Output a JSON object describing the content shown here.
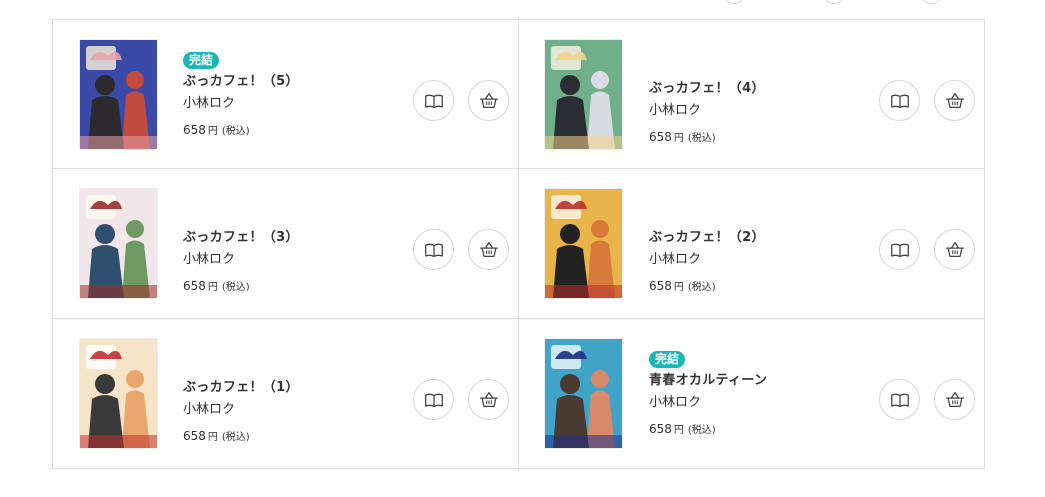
{
  "books": [
    {
      "badge": "完結",
      "title": "ぶっカフェ！（5）",
      "author": "小林ロク",
      "price": "658",
      "yen": "円",
      "tax": "(税込)",
      "cover": {
        "bg": "#3b4aa6",
        "accent": "#e8a3a8",
        "figure": "#2c2a2f",
        "figure2": "#c24a3f",
        "light": "#f2e6d8"
      }
    },
    {
      "badge": "",
      "title": "ぶっカフェ！（4）",
      "author": "小林ロク",
      "price": "658",
      "yen": "円",
      "tax": "(税込)",
      "cover": {
        "bg": "#6fb08a",
        "accent": "#f0d38a",
        "figure": "#2b2d33",
        "figure2": "#d9dbe3",
        "light": "#f4efe3"
      }
    },
    {
      "badge": "",
      "title": "ぶっカフェ！（3）",
      "author": "小林ロク",
      "price": "658",
      "yen": "円",
      "tax": "(税込)",
      "cover": {
        "bg": "#f1e7ea",
        "accent": "#9a2d2a",
        "figure": "#2e4f6e",
        "figure2": "#6e9a61",
        "light": "#fff8f2"
      }
    },
    {
      "badge": "",
      "title": "ぶっカフェ！（2）",
      "author": "小林ロク",
      "price": "658",
      "yen": "円",
      "tax": "(税込)",
      "cover": {
        "bg": "#e9b44a",
        "accent": "#b9302c",
        "figure": "#222222",
        "figure2": "#d87a3a",
        "light": "#fbf3e2"
      }
    },
    {
      "badge": "",
      "title": "ぶっカフェ！（1）",
      "author": "小林ロク",
      "price": "658",
      "yen": "円",
      "tax": "(税込)",
      "cover": {
        "bg": "#f6e4c8",
        "accent": "#c2302c",
        "figure": "#3a3a3a",
        "figure2": "#e9a66d",
        "light": "#ffffff"
      }
    },
    {
      "badge": "完結",
      "title": "青春オカルティーン",
      "author": "小林ロク",
      "price": "658",
      "yen": "円",
      "tax": "(税込)",
      "cover": {
        "bg": "#3fa4c7",
        "accent": "#1e2f86",
        "figure": "#4a3a32",
        "figure2": "#d98a6a",
        "light": "#e7f4fb"
      }
    }
  ],
  "icons": {
    "read": "book-open-icon",
    "cart": "basket-icon"
  },
  "colors": {
    "badge": "#1ab6b9",
    "border": "#dcdcdc",
    "text": "#333333"
  }
}
